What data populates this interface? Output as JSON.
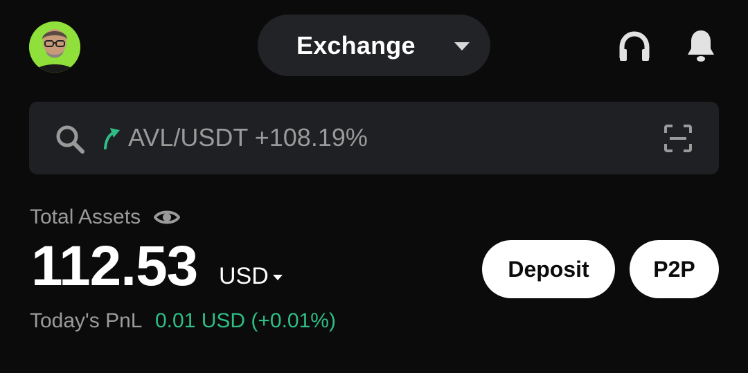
{
  "header": {
    "avatar_icon": "user-avatar",
    "mode_label": "Exchange",
    "support_icon": "headset-icon",
    "notification_icon": "bell-icon"
  },
  "search": {
    "icon": "search-icon",
    "trend_icon": "arrow-up-right-icon",
    "trend_color": "#2ebd85",
    "text": "AVL/USDT +108.19%",
    "scan_icon": "scan-icon"
  },
  "assets": {
    "label": "Total Assets",
    "visibility_icon": "eye-icon",
    "balance": "112.53",
    "currency": "USD",
    "pnl_label": "Today's PnL",
    "pnl_value": "0.01 USD (+0.01%)",
    "pnl_color": "#2ebd85"
  },
  "actions": {
    "deposit_label": "Deposit",
    "p2p_label": "P2P"
  }
}
